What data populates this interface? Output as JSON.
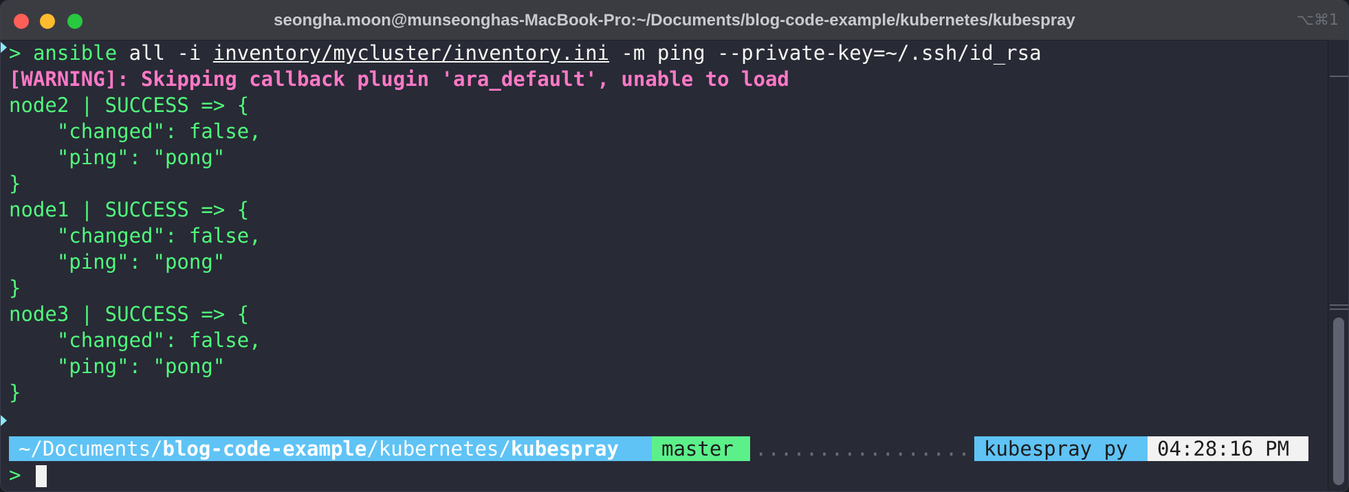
{
  "window": {
    "title": "seongha.moon@munseonghas-MacBook-Pro:~/Documents/blog-code-example/kubernetes/kubespray",
    "shortcut": "⌥⌘1"
  },
  "terminal": {
    "command": {
      "prompt": ">",
      "program": "ansible",
      "arg1": " all -i ",
      "inventory_path": "inventory/mycluster/inventory.ini",
      "rest": " -m ping --private-key=~/.ssh/id_rsa"
    },
    "warning": "[WARNING]: Skipping callback plugin 'ara_default', unable to load",
    "lines": [
      "node2 | SUCCESS => {",
      "    \"changed\": false,",
      "    \"ping\": \"pong\"",
      "}",
      "node1 | SUCCESS => {",
      "    \"changed\": false,",
      "    \"ping\": \"pong\"",
      "}",
      "node3 | SUCCESS => {",
      "    \"changed\": false,",
      "    \"ping\": \"pong\"",
      "}"
    ],
    "statusbar": {
      "path_prefix": "~/Documents/",
      "path_bold_1": "blog-code-example",
      "path_mid": "/kubernetes/",
      "path_bold_2": "kubespray",
      "git_branch": "master",
      "filler": "..................................",
      "env": "kubespray py",
      "time": "04:28:16 PM"
    },
    "prompt": ">"
  },
  "colors": {
    "background": "#282a36",
    "green": "#50fa7b",
    "pink": "#ff79c6",
    "path_segment": "#5fc3f5",
    "git_segment": "#5cf08a"
  }
}
